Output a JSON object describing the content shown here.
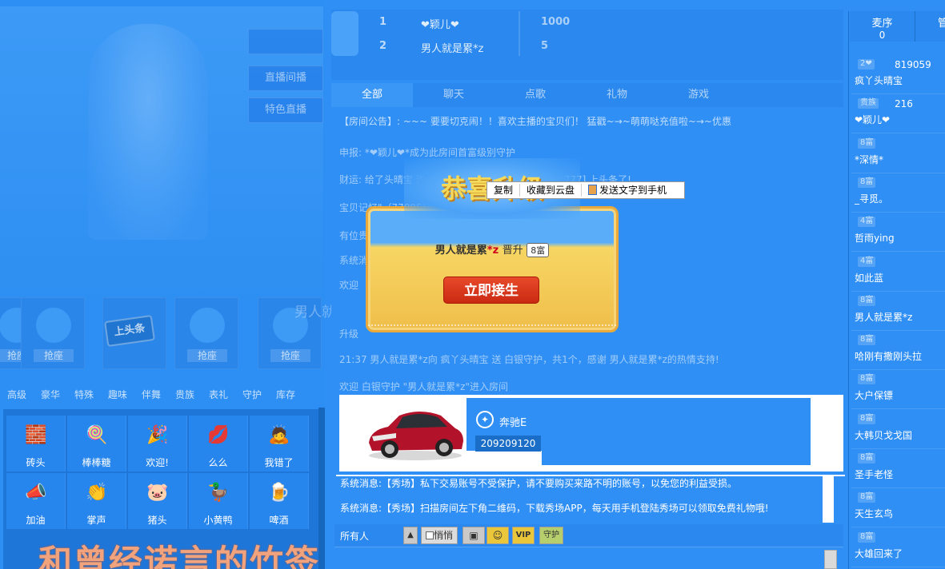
{
  "video": {
    "overlay_buttons": [
      "",
      "直播间播",
      "特色直播"
    ],
    "seat_grab_label": "抢座",
    "headline_sign": "上头条",
    "watermark_name": "男人就是累"
  },
  "gift_categories": [
    "高级",
    "豪华",
    "特殊",
    "趣味",
    "伴舞",
    "贵族",
    "表礼",
    "守护",
    "库存"
  ],
  "gifts": [
    {
      "label": "砖头",
      "icon": "brick-icon",
      "glyph": "🧱"
    },
    {
      "label": "棒棒糖",
      "icon": "lollipop-icon",
      "glyph": "🍭"
    },
    {
      "label": "欢迎!",
      "icon": "welcome-icon",
      "glyph": "🎉"
    },
    {
      "label": "么么",
      "icon": "kiss-icon",
      "glyph": "💋"
    },
    {
      "label": "我错了",
      "icon": "sorry-icon",
      "glyph": "🙇"
    },
    {
      "label": "加油",
      "icon": "cheer-icon",
      "glyph": "📣"
    },
    {
      "label": "掌声",
      "icon": "applause-icon",
      "glyph": "👏"
    },
    {
      "label": "猪头",
      "icon": "pig-icon",
      "glyph": "🐷"
    },
    {
      "label": "小黄鸭",
      "icon": "duck-icon",
      "glyph": "🦆"
    },
    {
      "label": "啤酒",
      "icon": "beer-icon",
      "glyph": "🍺"
    }
  ],
  "overlay_slogan": "和曾经诺言的竹签",
  "rank": {
    "rows": [
      {
        "num": "1",
        "name": "❤颖儿❤",
        "score": "1000"
      },
      {
        "num": "2",
        "name": "男人就是累*z",
        "score": "5"
      }
    ]
  },
  "chat_tabs": [
    "全部",
    "聊天",
    "点歌",
    "礼物",
    "游戏"
  ],
  "chat_lines": [
    "【房间公告】: ~~~ 要要切克闹！！喜欢主播的宝贝们！ 猛戳~→~萌萌哒充值啦~→~优惠",
    "申报: *❤颖儿❤*成为此房间首富级别守护",
    "财运: 给了头晴宝  送出... 送为 ◇ 大家送东～◇ 圆[20777] 上头条了!",
    "                    宝贝记忆\"（77895）上缴1个月工资!",
    "有位贵",
    "系统消",
    "欢迎",
    "升级 ",
    "21:37  男人就是累*z向 疯丫头晴宝 送 白银守护，共1个，感谢 男人就是累*z的热情支持!",
    "欢迎 白银守护 \"男人就是累*z\"进入房间"
  ],
  "upgrade_popup": {
    "banner": "恭喜升级",
    "nickname": "男人就是累",
    "nick_tail": "*z",
    "verb": "晋升",
    "level": "8富",
    "button": "立即接生"
  },
  "context_menu": {
    "copy": "复制",
    "save_cloud": "收藏到云盘",
    "send_phone": "发送文字到手机"
  },
  "car_card": {
    "name": "奔驰E",
    "price": "209209120"
  },
  "system_messages": [
    "系统消息:【秀场】私下交易账号不受保护，请不要购买来路不明的账号，以免您的利益受损。",
    "系统消息:【秀场】扫描房间左下角二维码，下载秀场APP，每天用手机登陆秀场可以领取免费礼物哦!"
  ],
  "input_toolbar": {
    "recipient": "所有人",
    "whisper_label": "悄悄",
    "vip_label": "VIP",
    "guard_label": "守护"
  },
  "user_panel": {
    "tab_mic_label": "麦序",
    "tab_mic_count": "0",
    "tab_admin_label": "管",
    "users": [
      {
        "level": "2❤",
        "extra": "819059",
        "name": "疯丫头晴宝"
      },
      {
        "level": "贵族",
        "extra": "216",
        "name": "❤颖儿❤"
      },
      {
        "level": "8富",
        "extra": "",
        "name": "*深情*"
      },
      {
        "level": "8富",
        "extra": "",
        "name": "_寻觅。"
      },
      {
        "level": "4富",
        "extra": "",
        "name": "哲雨ying"
      },
      {
        "level": "4富",
        "extra": "",
        "name": "如此蓝"
      },
      {
        "level": "8富",
        "extra": "",
        "name": "男人就是累*z"
      },
      {
        "level": "8富",
        "extra": "",
        "name": "哈刚有撒刚头拉"
      },
      {
        "level": "8富",
        "extra": "",
        "name": "大户保镖"
      },
      {
        "level": "8富",
        "extra": "",
        "name": "大韩贝戈戈国"
      },
      {
        "level": "8富",
        "extra": "",
        "name": "圣手老怪"
      },
      {
        "level": "8富",
        "extra": "",
        "name": "天生玄鸟"
      },
      {
        "level": "8富",
        "extra": "",
        "name": "大雄回来了"
      }
    ]
  },
  "colors": {
    "page_bg": "#2f8ff5",
    "popup_gold": "#f0be4a",
    "button_red": "#d9371c",
    "slogan": "#f0a37d"
  }
}
